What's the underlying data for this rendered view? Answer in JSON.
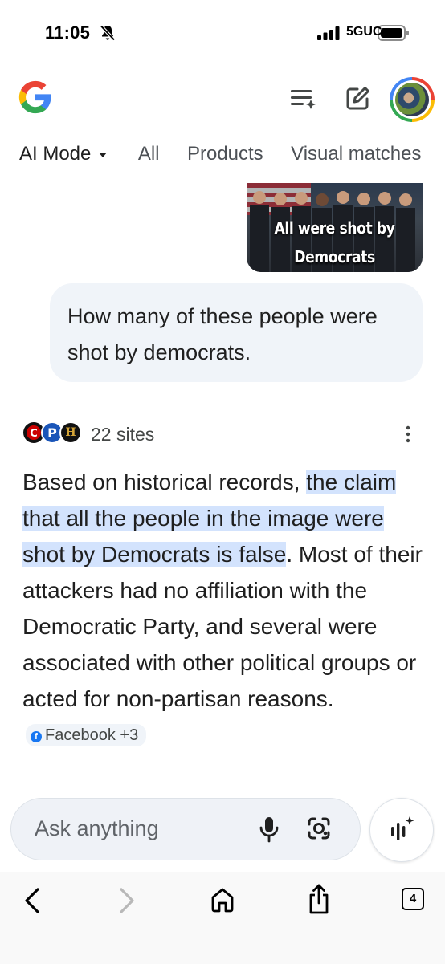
{
  "status_bar": {
    "time": "11:05",
    "network": "5GUC",
    "icons": [
      "bell-slash-icon",
      "signal-icon",
      "battery-icon"
    ]
  },
  "header": {
    "logo": "google-g-logo",
    "icons": [
      "history-icon",
      "compose-icon",
      "avatar"
    ]
  },
  "tabs": [
    {
      "label": "AI Mode",
      "active": true
    },
    {
      "label": "All",
      "active": false
    },
    {
      "label": "Products",
      "active": false
    },
    {
      "label": "Visual matches",
      "active": false
    }
  ],
  "attached_image": {
    "caption_line1": "All were shot by",
    "caption_line2": "Democrats"
  },
  "query": "How many of these people were shot by democrats.",
  "sources": {
    "label": "22 sites",
    "icons": [
      "cnn-icon",
      "p-icon",
      "history-icon"
    ]
  },
  "answer": {
    "part1": "Based on historical records, ",
    "highlight": "the claim that all the people in the image were shot by Democrats is false",
    "part2": ". Most of their attackers had no affiliation with the Democratic Party, and several were associated with other political groups or acted for non-partisan reasons.",
    "chip": "Facebook +3"
  },
  "input": {
    "placeholder": "Ask anything"
  },
  "toolbar": {
    "tab_count": "4",
    "icons": [
      "back-icon",
      "forward-icon",
      "home-icon",
      "share-icon",
      "tabs-icon"
    ]
  },
  "colors": {
    "highlight": "#d3e3fd",
    "bubble": "#f0f4f9",
    "text": "#1f1f1f"
  }
}
